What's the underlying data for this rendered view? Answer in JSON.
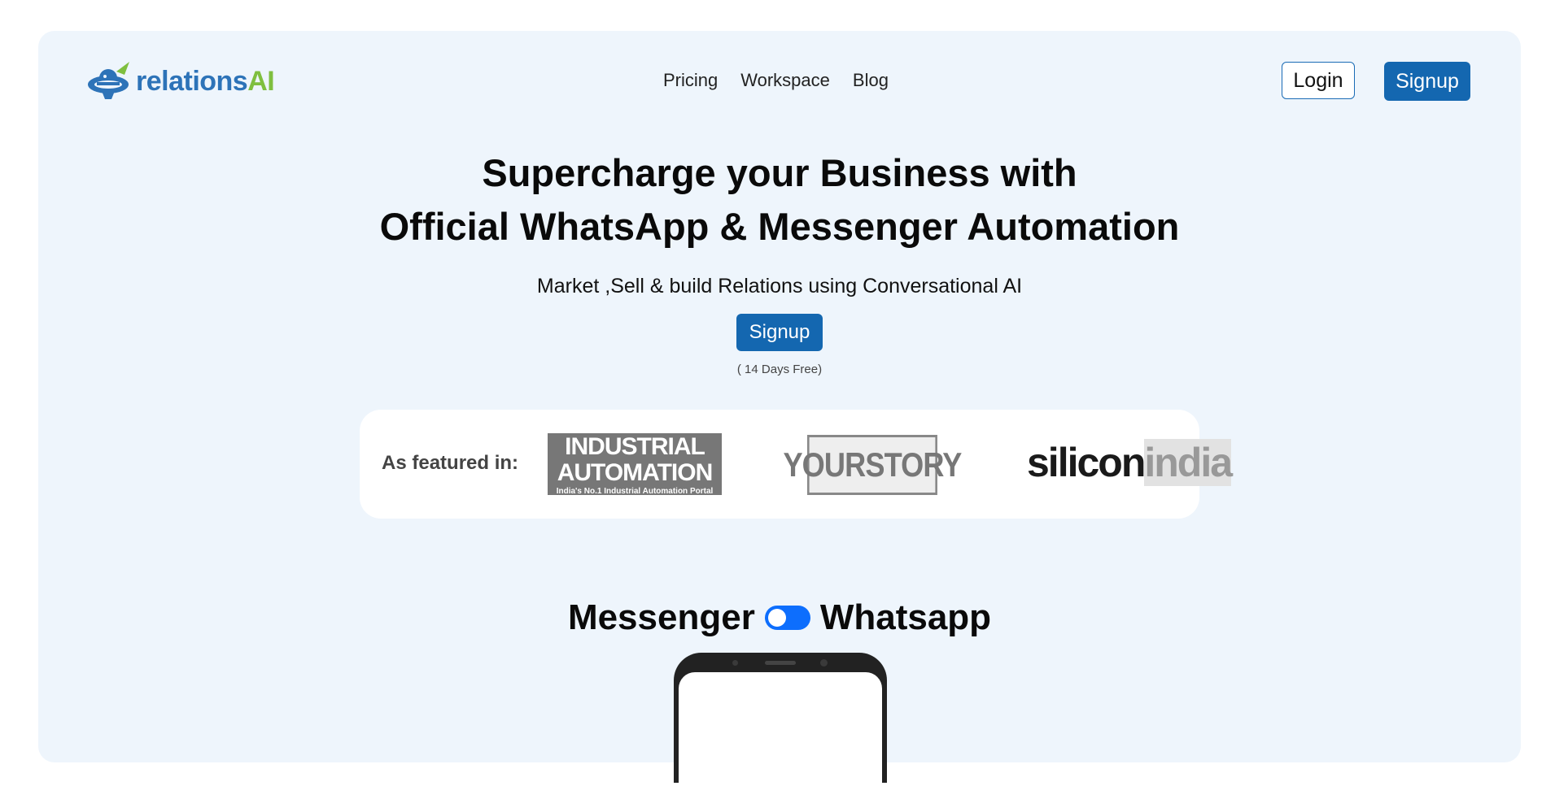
{
  "header": {
    "logo_text_a": "relations",
    "logo_text_b": "AI",
    "nav": [
      "Pricing",
      "Workspace",
      "Blog"
    ],
    "login_label": "Login",
    "signup_label": "Signup"
  },
  "hero": {
    "title_line1": "Supercharge your Business with",
    "title_line2": "Official WhatsApp & Messenger Automation",
    "subtitle": "Market ,Sell & build Relations using Conversational AI",
    "signup_label": "Signup",
    "free_note": "( 14 Days Free)"
  },
  "featured": {
    "label": "As featured in:",
    "industrial_automation": {
      "line1": "INDUSTRIAL",
      "line2": "AUTOMATION",
      "tagline": "India's No.1 Industrial Automation Portal"
    },
    "yourstory": "YOURSTORY",
    "siliconindia_a": "silicon",
    "siliconindia_b": "india"
  },
  "toggle": {
    "left_label": "Messenger",
    "right_label": "Whatsapp",
    "state": "off"
  },
  "colors": {
    "brand_blue": "#1467b0",
    "brand_green": "#7fbf3f",
    "card_bg": "#eef5fc",
    "toggle_blue": "#0d6efd"
  }
}
